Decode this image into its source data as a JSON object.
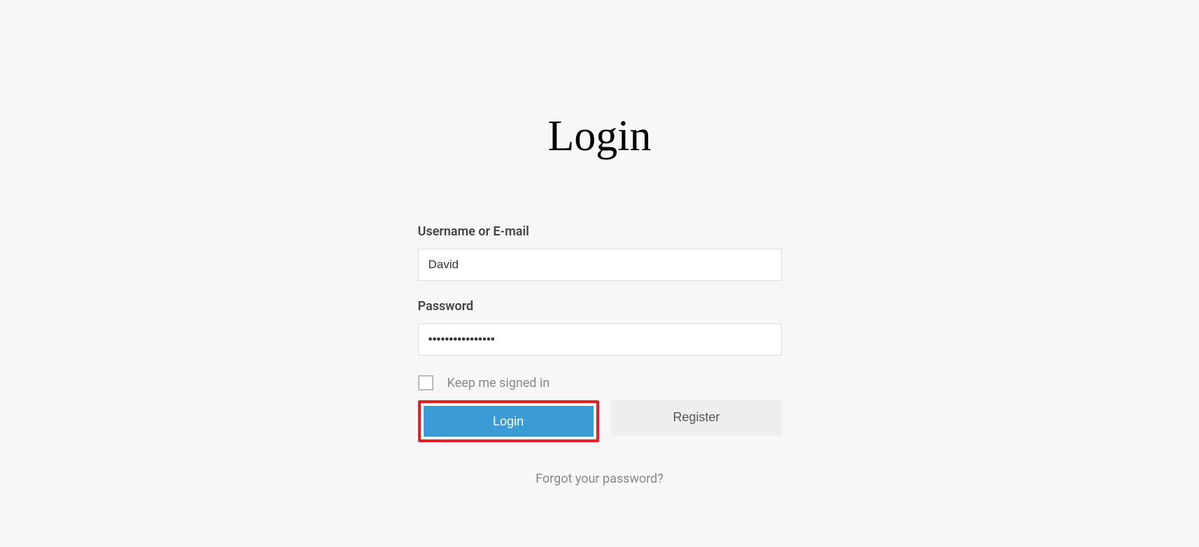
{
  "title": "Login",
  "form": {
    "username_label": "Username or E-mail",
    "username_value": "David",
    "password_label": "Password",
    "password_value": "••••••••••••••••",
    "keep_signed_in_label": "Keep me signed in",
    "login_button": "Login",
    "register_button": "Register",
    "forgot_password": "Forgot your password?"
  }
}
